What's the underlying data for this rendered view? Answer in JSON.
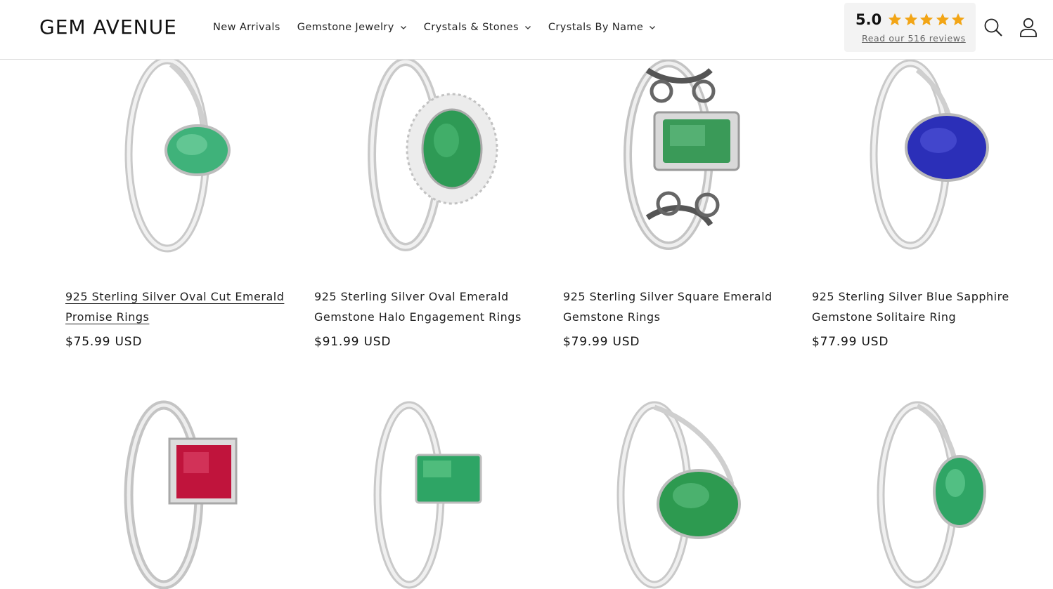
{
  "brand": {
    "logo_text": "GEM AVENUE"
  },
  "nav": {
    "items": [
      {
        "label": "New Arrivals",
        "has_dropdown": false
      },
      {
        "label": "Gemstone Jewelry",
        "has_dropdown": true
      },
      {
        "label": "Crystals & Stones",
        "has_dropdown": true
      },
      {
        "label": "Crystals By Name",
        "has_dropdown": true
      }
    ]
  },
  "reviews": {
    "rating": "5.0",
    "stars": 5,
    "link_text": "Read our 516 reviews",
    "star_color": "#f2a516"
  },
  "header_icons": [
    "search-icon",
    "account-icon"
  ],
  "products": [
    {
      "title": "925 Sterling Silver Oval Cut Emerald Promise Rings",
      "price": "$75.99 USD",
      "stone_color": "#3fb27a",
      "stone_shape": "oval-cut"
    },
    {
      "title": "925 Sterling Silver Oval Emerald Gemstone Halo Engagement Rings",
      "price": "$91.99 USD",
      "stone_color": "#2e9a55",
      "stone_shape": "oval-halo"
    },
    {
      "title": "925 Sterling Silver Square Emerald Gemstone Rings",
      "price": "$79.99 USD",
      "stone_color": "#3a9a58",
      "stone_shape": "emerald-cut"
    },
    {
      "title": "925 Sterling Silver Blue Sapphire Gemstone Solitaire Ring",
      "price": "$77.99 USD",
      "stone_color": "#2b2fb8",
      "stone_shape": "oval"
    },
    {
      "title": "",
      "price": "",
      "stone_color": "#c0143c",
      "stone_shape": "square"
    },
    {
      "title": "",
      "price": "",
      "stone_color": "#2ea565",
      "stone_shape": "emerald-cut"
    },
    {
      "title": "",
      "price": "",
      "stone_color": "#2d9a50",
      "stone_shape": "oval"
    },
    {
      "title": "",
      "price": "",
      "stone_color": "#2fa565",
      "stone_shape": "oval-vertical"
    }
  ]
}
